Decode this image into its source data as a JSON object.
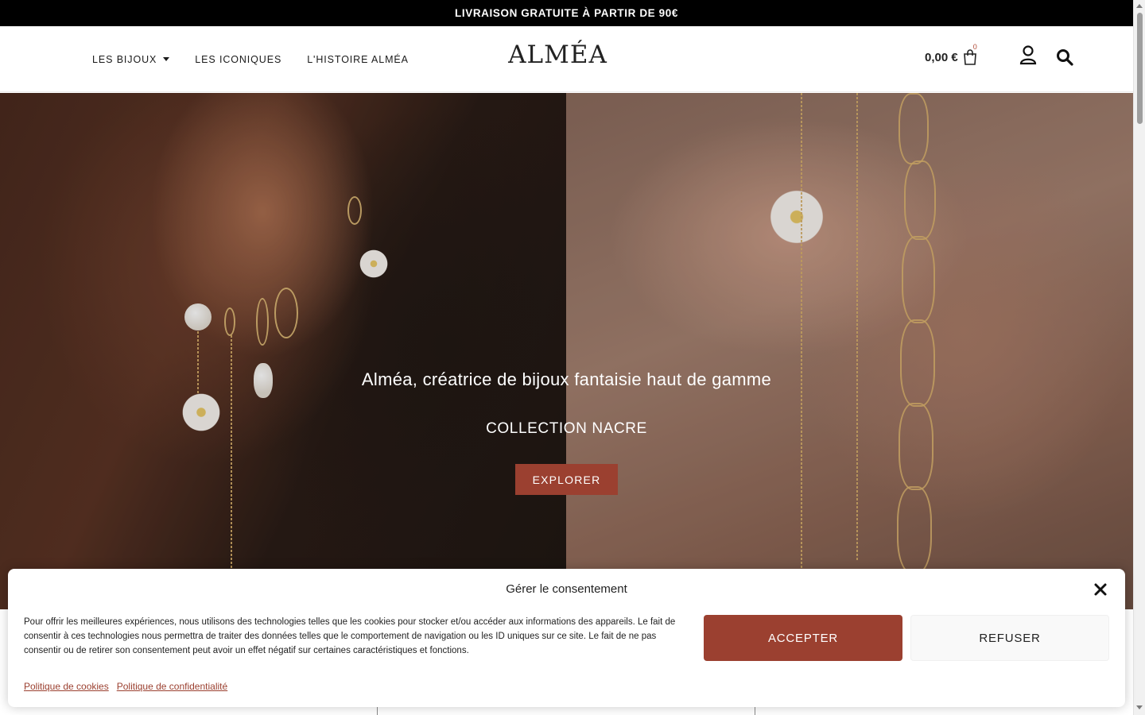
{
  "topbar": {
    "text": "LIVRAISON GRATUITE À PARTIR DE 90€"
  },
  "nav": {
    "items": [
      {
        "label": "LES BIJOUX",
        "has_dropdown": true
      },
      {
        "label": "LES ICONIQUES"
      },
      {
        "label": "L'HISTOIRE ALMÉA"
      }
    ]
  },
  "logo": {
    "text": "ALMÉA"
  },
  "cart": {
    "total": "0,00 €",
    "count": "0",
    "icon": "shopping-bag-icon"
  },
  "header_icons": {
    "user": "user-icon",
    "search": "search-icon"
  },
  "hero": {
    "title": "Alméa, créatrice de bijoux fantaisie haut de gamme",
    "subtitle": "COLLECTION NACRE",
    "button": "EXPLORER"
  },
  "consent": {
    "title": "Gérer le consentement",
    "text": "Pour offrir les meilleures expériences, nous utilisons des technologies telles que les cookies pour stocker et/ou accéder aux informations des appareils. Le fait de consentir à ces technologies nous permettra de traiter des données telles que le comportement de navigation ou les ID uniques sur ce site. Le fait de ne pas consentir ou de retirer son consentement peut avoir un effet négatif sur certaines caractéristiques et fonctions.",
    "accept": "ACCEPTER",
    "refuse": "REFUSER",
    "links": [
      "Politique de cookies",
      "Politique de confidentialité"
    ]
  },
  "colors": {
    "accent": "#9b4030",
    "topbar_bg": "#000000",
    "text": "#1a1a1a"
  }
}
